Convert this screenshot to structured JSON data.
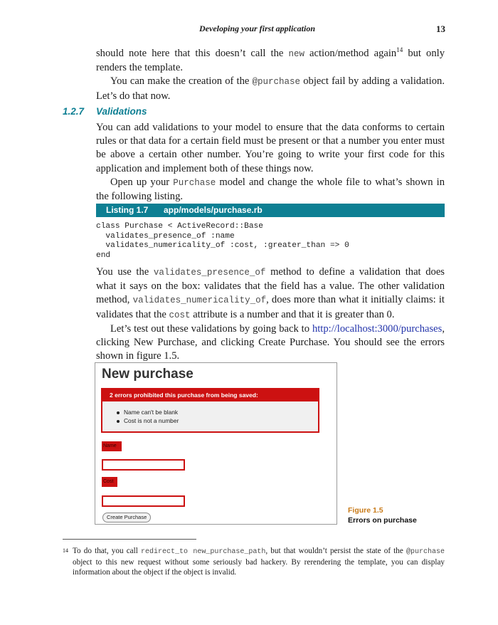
{
  "running_head": {
    "title": "Developing your first application",
    "page_number": "13"
  },
  "para1": {
    "t1": "should note here that this doesn’t call the ",
    "code1": "new",
    "t2": " action/method again",
    "note_ref": "14",
    "t3": " but only renders the template."
  },
  "para2": {
    "t1": "You can make the creation of the ",
    "code1": "@purchase",
    "t2": " object fail by adding a validation. Let’s do that now."
  },
  "section": {
    "number": "1.2.7",
    "title": "Validations"
  },
  "para3": "You can add validations to your model to ensure that the data conforms to certain rules or that data for a certain field must be present or that a number you enter must be above a certain other number. You’re going to write your first code for this application and implement both of these things now.",
  "para4": {
    "t1": "Open up your ",
    "code1": "Purchase",
    "t2": " model and change the whole file to what’s shown in the following listing."
  },
  "listing": {
    "label": "Listing 1.7",
    "path": "app/models/purchase.rb",
    "lines": [
      "class Purchase < ActiveRecord::Base",
      "  validates_presence_of :name",
      "  validates_numericality_of :cost, :greater_than => 0",
      "end"
    ]
  },
  "para5": {
    "t1": "You use the ",
    "code1": "validates_presence_of",
    "t2": " method to define a validation that does what it says on the box: validates that the field has a value. The other validation method, ",
    "code2": "validates_numericality_of",
    "t3": ", does more than what it initially claims: it validates that the ",
    "code3": "cost",
    "t4": " attribute is a number and that it is greater than 0."
  },
  "para6": {
    "t1": "Let’s test out these validations by going back to ",
    "link": "http://localhost:3000/purchases",
    "t2": ", clicking New Purchase, and clicking Create Purchase. You should see the errors shown in figure 1.5."
  },
  "figure": {
    "heading": "New purchase",
    "error_header": "2 errors prohibited this purchase from being saved:",
    "errors": [
      "Name can't be blank",
      "Cost is not a number"
    ],
    "name_label": "Name",
    "cost_label": "Cost",
    "submit": "Create Purchase",
    "caption_number": "Figure 1.5",
    "caption_text": "Errors on purchase"
  },
  "footnote": {
    "mark": "14",
    "t1": "To do that, you call ",
    "code1": "redirect_to new_purchase_path",
    "t2": ", but that wouldn’t persist the state of the ",
    "code2": "@purchase",
    "t3": " object to this new request without some seriously bad hackery. By rerendering the template, you can display information about the object if the object is invalid."
  }
}
